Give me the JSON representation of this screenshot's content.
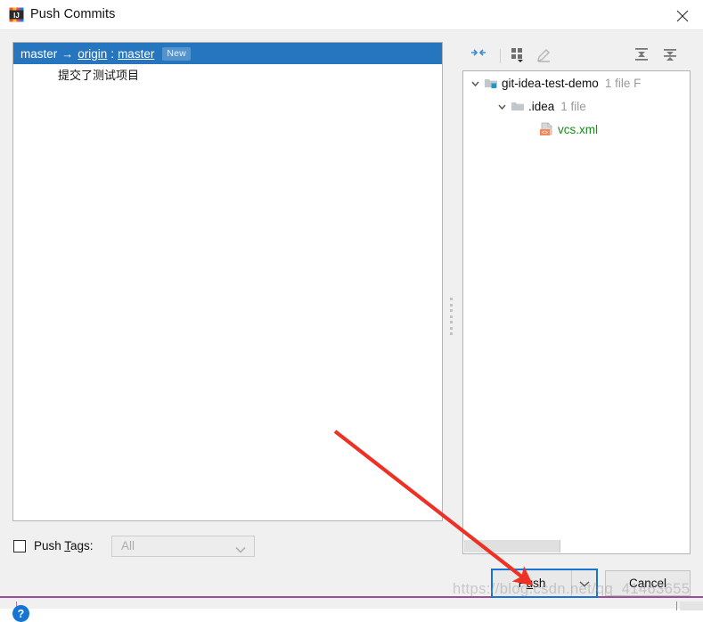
{
  "window": {
    "title": "Push Commits",
    "app_icon": "intellij-idea-icon",
    "close_icon": "close-icon"
  },
  "commits": {
    "groups": [
      {
        "local_branch": "master",
        "arrow": "→",
        "remote": "origin",
        "separator": ":",
        "remote_branch": "master",
        "badge": "New",
        "selected": true,
        "commits": [
          {
            "message": "提交了测试项目"
          }
        ]
      }
    ]
  },
  "tree_toolbar": {
    "buttons": [
      {
        "name": "collapse-diff-icon",
        "label": "Show Diff Preview",
        "enabled": true
      },
      {
        "name": "group-by-icon",
        "label": "Group By",
        "enabled": true
      },
      {
        "name": "edit-source-icon",
        "label": "Edit Source",
        "enabled": false
      },
      {
        "name": "expand-all-icon",
        "label": "Expand All",
        "enabled": true
      },
      {
        "name": "collapse-all-icon",
        "label": "Collapse All",
        "enabled": true
      }
    ]
  },
  "tree": {
    "nodes": [
      {
        "label": "git-idea-test-demo",
        "meta": "1 file F",
        "icon": "module-folder-icon",
        "caret": "chevron-down-icon",
        "depth": 0,
        "expanded": true,
        "type": "folder"
      },
      {
        "label": ".idea",
        "meta": "1 file",
        "icon": "folder-icon",
        "caret": "chevron-down-icon",
        "depth": 1,
        "expanded": true,
        "type": "folder"
      },
      {
        "label": "vcs.xml",
        "meta": "",
        "icon": "xml-file-icon",
        "caret": "",
        "depth": 2,
        "expanded": false,
        "type": "file",
        "status_color": "#1a8a1a"
      }
    ]
  },
  "push_tags": {
    "label_pre": "Push ",
    "label_mnemonic": "T",
    "label_post": "ags:",
    "checked": false,
    "combo_value": "All",
    "combo_enabled": false,
    "chevron_icon": "chevron-down-icon"
  },
  "footer": {
    "help_label": "?",
    "help_icon": "help-icon",
    "push_pre": "P",
    "push_mnemonic": "u",
    "push_post": "sh",
    "push_dropdown_icon": "chevron-down-icon",
    "cancel_label": "Cancel"
  },
  "annotation": {
    "arrow_color": "#ee3124",
    "watermark": "https://blog.csdn.net/qq_41463655"
  },
  "colors": {
    "selection_blue": "#2675bf",
    "focus_ring": "#1a73d0",
    "dialog_bg": "#f0f0f0",
    "added_file_green": "#1a8a1a",
    "behind_window_line": "#9b4d9b"
  }
}
